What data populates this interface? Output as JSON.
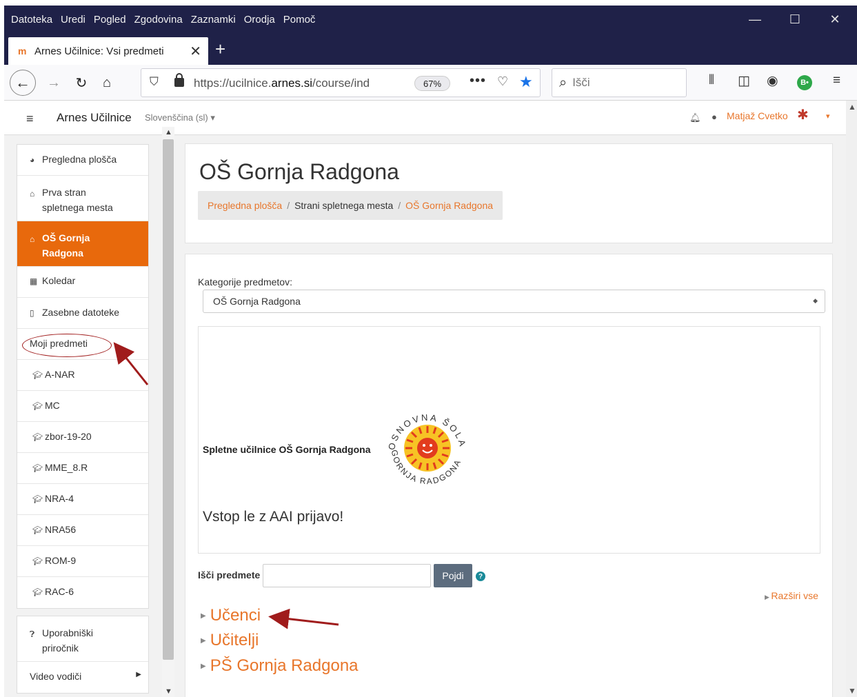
{
  "browser": {
    "menu": [
      {
        "label": "Datoteka"
      },
      {
        "label": "Uredi"
      },
      {
        "label": "Pogled"
      },
      {
        "label": "Zgodovina"
      },
      {
        "label": "Zaznamki"
      },
      {
        "label": "Orodja"
      },
      {
        "label": "Pomoč"
      }
    ],
    "tab_title": "Arnes Učilnice: Vsi predmeti",
    "url_prefix": "https://ucilnice.",
    "url_domain": "arnes.si",
    "url_suffix": "/course/ind",
    "zoom": "67%",
    "search_placeholder": "Išči",
    "addon_badge": "B•"
  },
  "moodle": {
    "brand": "Arnes Učilnice",
    "language": "Slovenščina (sl)",
    "user_name": "Matjaž Cvetko"
  },
  "drawer": {
    "nav": [
      {
        "label": "Pregledna plošča",
        "icon": "dashboard-icon"
      },
      {
        "label": "Prva stran spletnega mesta",
        "icon": "home-icon"
      },
      {
        "label": "OŠ Gornja Radgona",
        "icon": "home-icon"
      },
      {
        "label": "Koledar",
        "icon": "calendar-icon"
      },
      {
        "label": "Zasebne datoteke",
        "icon": "file-icon"
      },
      {
        "label": "Moji predmeti"
      },
      {
        "label": "A-NAR",
        "icon": "graduation-cap-icon"
      },
      {
        "label": "MC",
        "icon": "graduation-cap-icon"
      },
      {
        "label": "zbor-19-20",
        "icon": "graduation-cap-icon"
      },
      {
        "label": "MME_8.R",
        "icon": "graduation-cap-icon"
      },
      {
        "label": "NRA-4",
        "icon": "graduation-cap-icon"
      },
      {
        "label": "NRA56",
        "icon": "graduation-cap-icon"
      },
      {
        "label": "ROM-9",
        "icon": "graduation-cap-icon"
      },
      {
        "label": "RAC-6",
        "icon": "graduation-cap-icon"
      }
    ],
    "help": [
      {
        "label": "Uporabniški priročnik",
        "icon": "question-circle-icon"
      },
      {
        "label": "Video vodiči"
      }
    ]
  },
  "header": {
    "title": "OŠ Gornja Radgona",
    "breadcrumb": [
      {
        "label": "Pregledna plošča"
      },
      {
        "label": "Strani spletnega mesta"
      },
      {
        "label": "OŠ Gornja Radgona"
      }
    ]
  },
  "main": {
    "category_label": "Kategorije predmetov:",
    "category_value": "OŠ Gornja Radgona",
    "info_title": "Spletne učilnice OŠ Gornja Radgona",
    "logo_text_top": "OSNOVNA ŠOLA",
    "logo_text_bottom": "GORNJA RADGONA",
    "login_note": "Vstop le z AAI prijavo!",
    "search_label": "Išči predmete",
    "search_button": "Pojdi",
    "expand_all": "Razširi vse",
    "categories": [
      {
        "label": "Učenci"
      },
      {
        "label": "Učitelji"
      },
      {
        "label": "PŠ Gornja Radgona"
      }
    ]
  },
  "colors": {
    "accent": "#e8690c",
    "link": "#e8762b",
    "annotation": "#a01c1c",
    "browser_bar": "#1f2148"
  }
}
